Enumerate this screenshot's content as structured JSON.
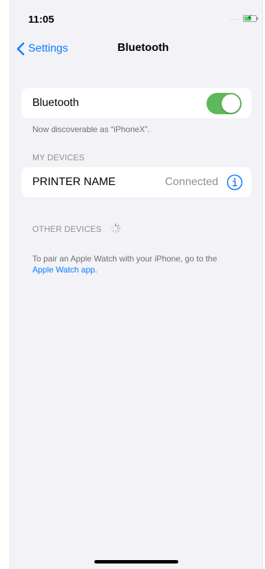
{
  "status_bar": {
    "time": "11:05",
    "signal": "....",
    "battery_level": 0.55,
    "battery_charging": true
  },
  "nav": {
    "back_label": "Settings",
    "title": "Bluetooth"
  },
  "bluetooth": {
    "label": "Bluetooth",
    "enabled": true,
    "discoverable_text": "Now discoverable as “iPhoneX”."
  },
  "my_devices": {
    "header": "MY DEVICES",
    "items": [
      {
        "name": "PRINTER NAME",
        "status": "Connected"
      }
    ]
  },
  "other_devices": {
    "header": "OTHER DEVICES"
  },
  "pair_note": {
    "text": "To pair an Apple Watch with your iPhone, go to the",
    "link": "Apple Watch app",
    "suffix": "."
  },
  "colors": {
    "accent": "#0a7cff",
    "toggle_on": "#5fb85b",
    "background": "#f2f2f7"
  },
  "icons": {
    "back": "chevron-left-icon",
    "info": "info-circle-icon",
    "spinner": "activity-spinner-icon",
    "battery": "battery-charging-icon"
  }
}
